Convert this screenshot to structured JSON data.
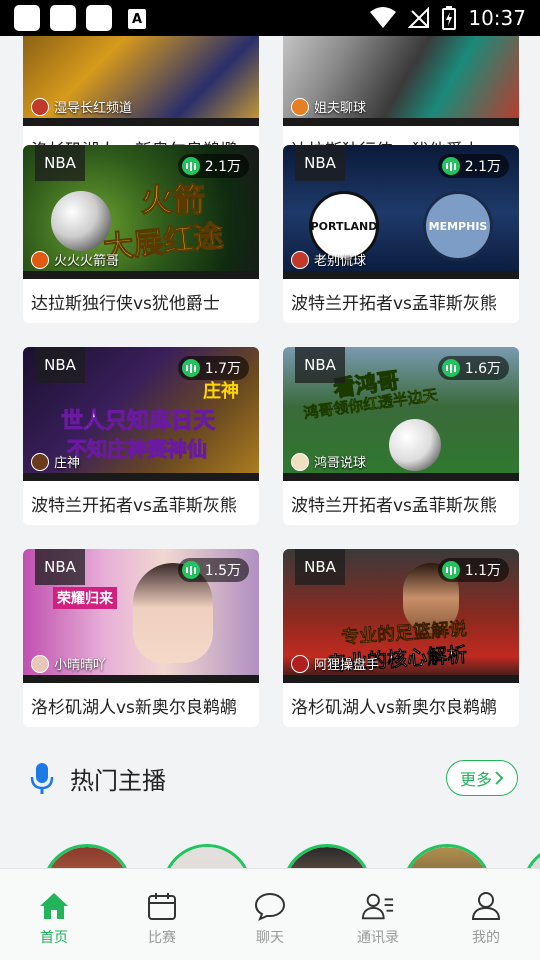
{
  "status_bar": {
    "time": "10:37"
  },
  "cards": [
    {
      "tag": "",
      "views": "",
      "anchor": "湿导长红频道",
      "title": "洛杉矶湖人vs新奥尔良鹈鹕"
    },
    {
      "tag": "",
      "views": "",
      "anchor": "姐夫聊球",
      "title": "达拉斯独行侠vs犹他爵士"
    },
    {
      "tag": "NBA",
      "views": "2.1万",
      "anchor": "火火火箭哥",
      "title": "达拉斯独行侠vs犹他爵士",
      "overlay1": "火箭",
      "overlay2": "大展红途"
    },
    {
      "tag": "NBA",
      "views": "2.1万",
      "anchor": "老别侃球",
      "title": "波特兰开拓者vs孟菲斯灰熊",
      "team1": "PORTLAND",
      "team2": "MEMPHIS"
    },
    {
      "tag": "NBA",
      "views": "1.7万",
      "anchor": "庄神",
      "title": "波特兰开拓者vs孟菲斯灰熊",
      "overlay1": "庄神",
      "overlay2": "世人只知库日天",
      "overlay3": "不知庄神赛神仙"
    },
    {
      "tag": "NBA",
      "views": "1.6万",
      "anchor": "鸿哥说球",
      "title": "波特兰开拓者vs孟菲斯灰熊",
      "overlay1": "看鸿哥",
      "overlay2": "鸿哥领你红透半边天"
    },
    {
      "tag": "NBA",
      "views": "1.5万",
      "anchor": "小晴晴吖",
      "title": "洛杉矶湖人vs新奥尔良鹈鹕",
      "overlay1": "荣耀归来"
    },
    {
      "tag": "NBA",
      "views": "1.1万",
      "anchor": "阿狸操盘手",
      "title": "洛杉矶湖人vs新奥尔良鹈鹕",
      "overlay1": "专业的足篮解说",
      "overlay2": "专业的核心解析"
    }
  ],
  "hot_section": {
    "title": "热门主播",
    "more_label": "更多"
  },
  "nav": [
    {
      "label": "首页",
      "icon": "home-icon",
      "active": true
    },
    {
      "label": "比赛",
      "icon": "calendar-icon",
      "active": false
    },
    {
      "label": "聊天",
      "icon": "chat-icon",
      "active": false
    },
    {
      "label": "通讯录",
      "icon": "contacts-icon",
      "active": false
    },
    {
      "label": "我的",
      "icon": "profile-icon",
      "active": false
    }
  ],
  "colors": {
    "accent": "#21b45a",
    "views_badge": "#21c45d"
  }
}
